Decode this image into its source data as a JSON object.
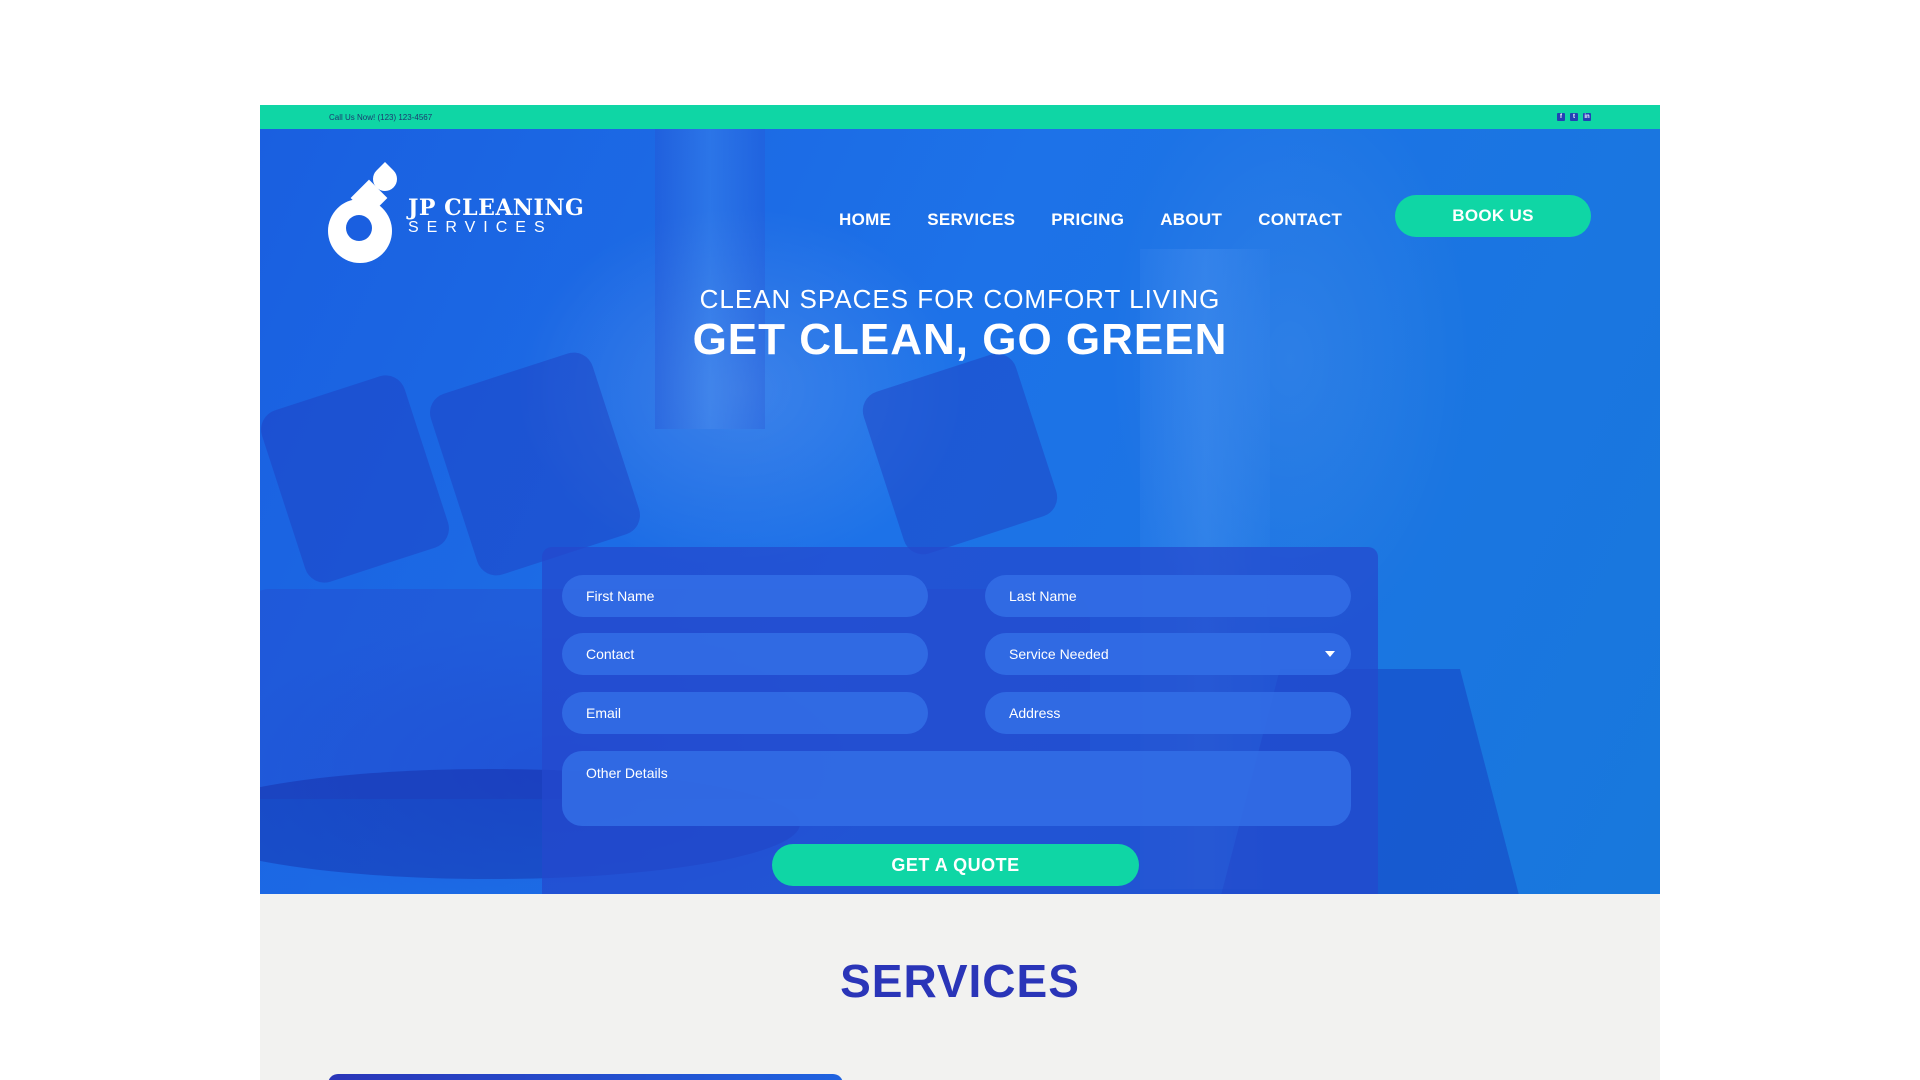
{
  "topbar": {
    "phone_text": "Call Us Now! (123) 123-4567",
    "socials": [
      {
        "icon": "facebook-icon",
        "glyph": "f"
      },
      {
        "icon": "twitter-icon",
        "glyph": "t"
      },
      {
        "icon": "linkedin-icon",
        "glyph": "in"
      }
    ]
  },
  "brand": {
    "line1": "JP CLEANING",
    "line2": "SERVICES"
  },
  "nav": {
    "items": [
      "HOME",
      "SERVICES",
      "PRICING",
      "ABOUT",
      "CONTACT"
    ],
    "cta": "BOOK US"
  },
  "hero": {
    "subtitle": "CLEAN SPACES FOR COMFORT LIVING",
    "title": "GET CLEAN, GO GREEN"
  },
  "form": {
    "first_name": "First Name",
    "last_name": "Last Name",
    "contact": "Contact",
    "service_needed": "Service Needed",
    "email": "Email",
    "address": "Address",
    "other_details": "Other Details",
    "submit": "GET A QUOTE"
  },
  "services": {
    "title": "SERVICES"
  },
  "colors": {
    "accent": "#0fd6a5",
    "hero_blue": "#1a5fe0",
    "services_title": "#2a35b8"
  }
}
